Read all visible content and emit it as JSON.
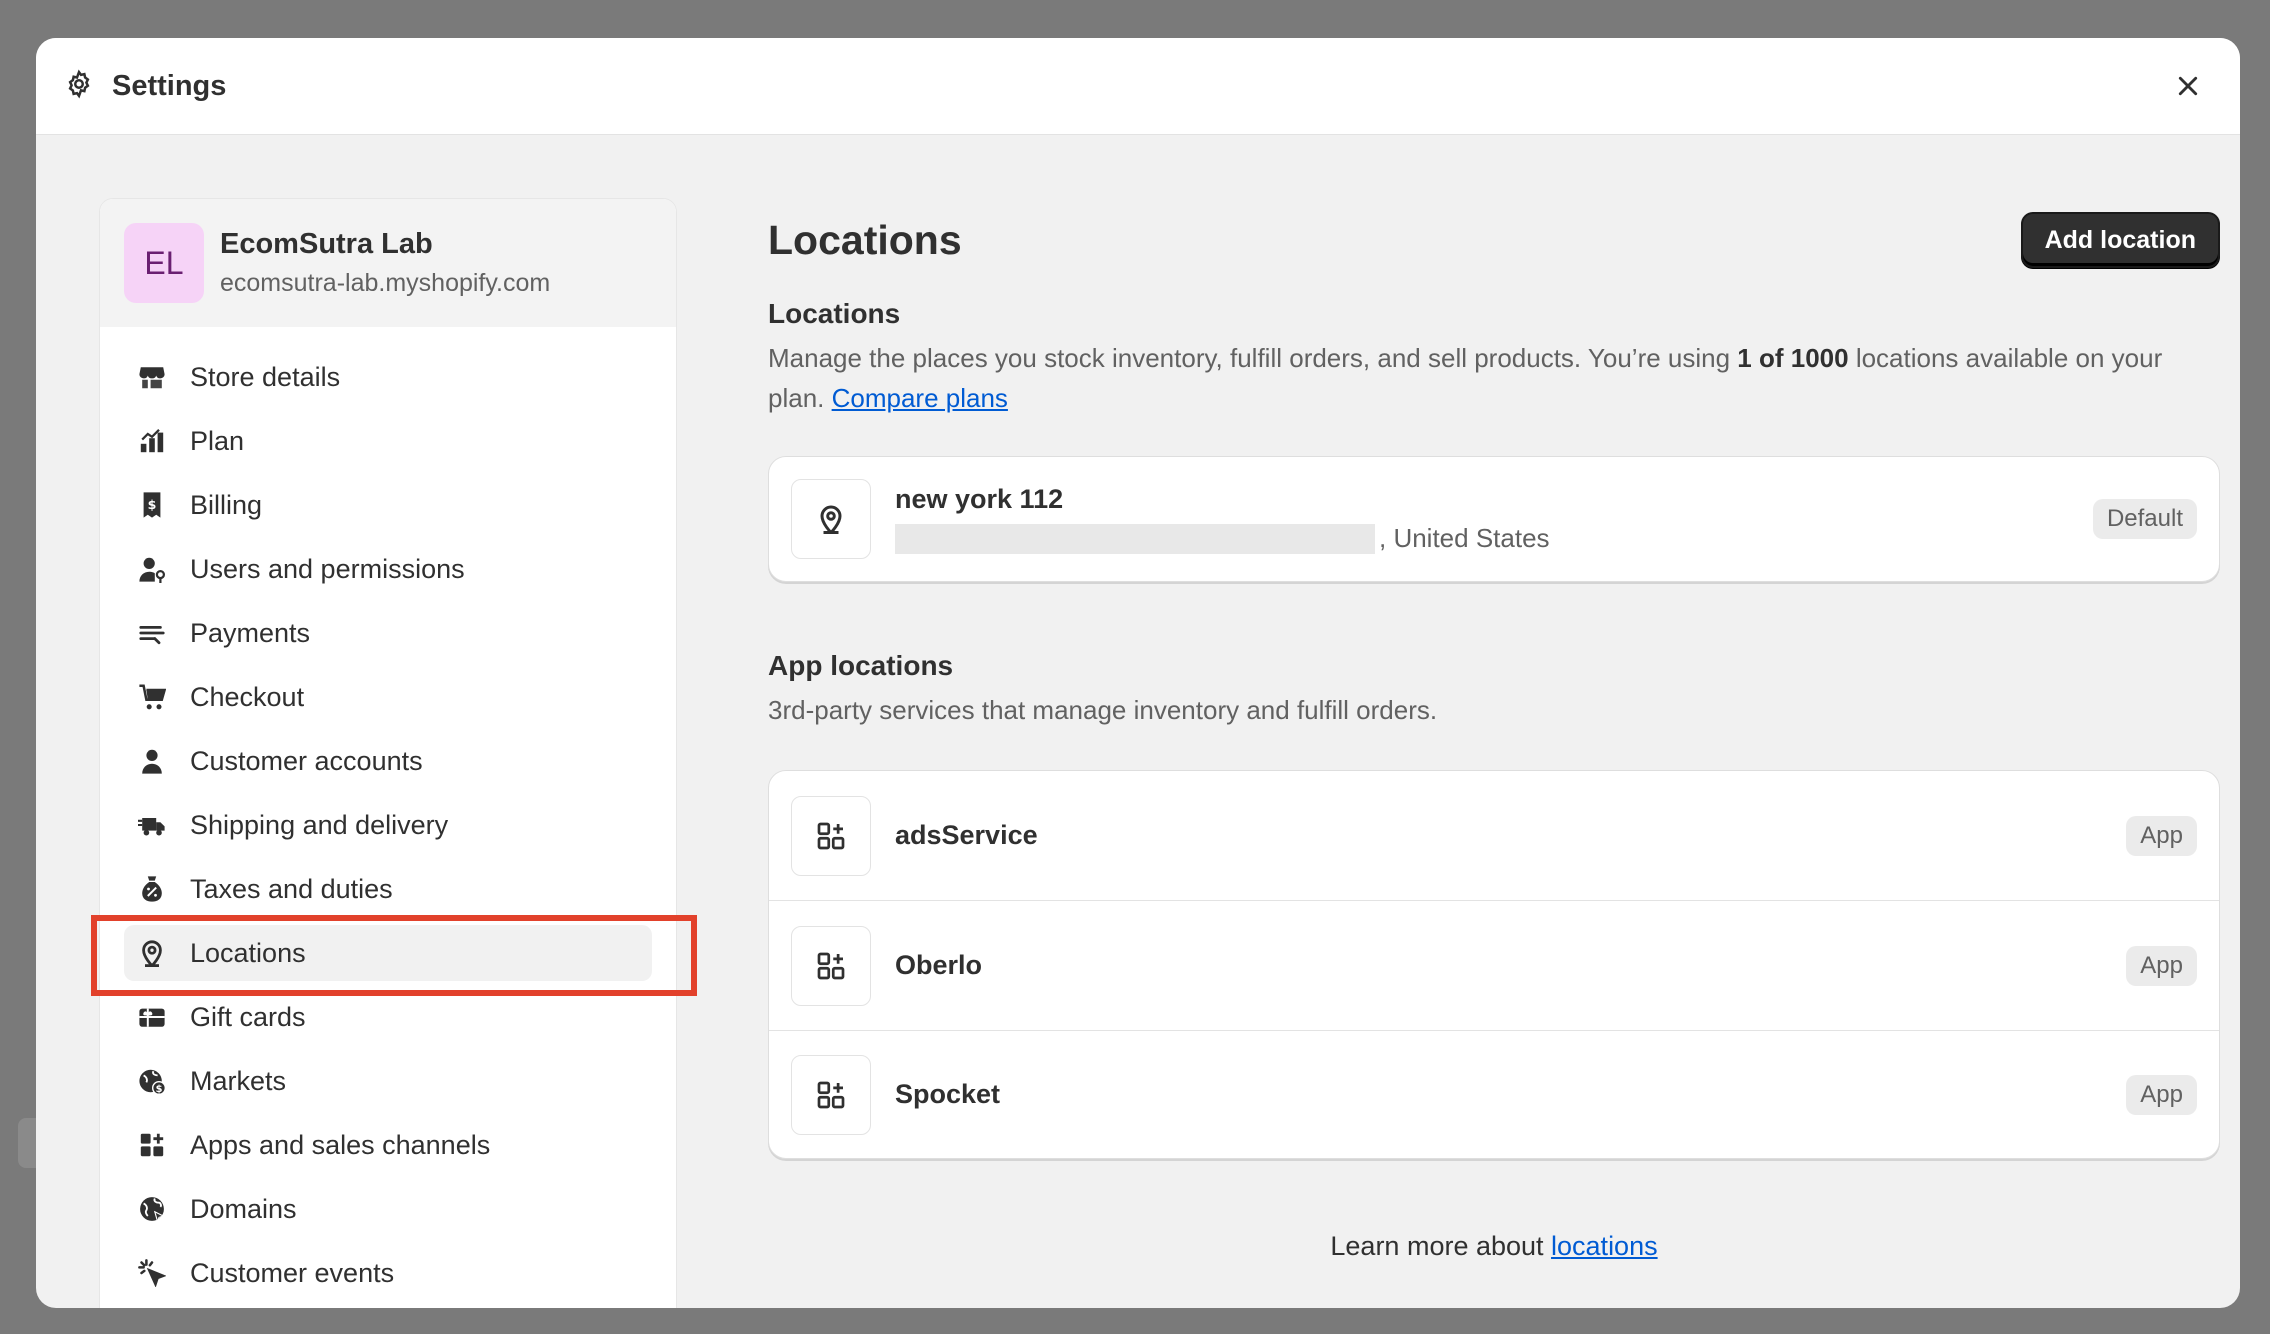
{
  "header": {
    "title": "Settings",
    "settings_icon": "gear-icon",
    "close_icon": "close-icon"
  },
  "store": {
    "initials": "EL",
    "name": "EcomSutra Lab",
    "domain": "ecomsutra-lab.myshopify.com",
    "avatar_color": "#f6d3f7"
  },
  "sidebar": {
    "items": [
      {
        "label": "Store details",
        "icon": "store-icon"
      },
      {
        "label": "Plan",
        "icon": "plan-icon"
      },
      {
        "label": "Billing",
        "icon": "billing-icon"
      },
      {
        "label": "Users and permissions",
        "icon": "users-icon"
      },
      {
        "label": "Payments",
        "icon": "payments-icon"
      },
      {
        "label": "Checkout",
        "icon": "cart-icon"
      },
      {
        "label": "Customer accounts",
        "icon": "person-icon"
      },
      {
        "label": "Shipping and delivery",
        "icon": "truck-icon"
      },
      {
        "label": "Taxes and duties",
        "icon": "tax-icon"
      },
      {
        "label": "Locations",
        "icon": "location-pin-icon",
        "active": true
      },
      {
        "label": "Gift cards",
        "icon": "gift-card-icon"
      },
      {
        "label": "Markets",
        "icon": "globe-currency-icon"
      },
      {
        "label": "Apps and sales channels",
        "icon": "apps-icon"
      },
      {
        "label": "Domains",
        "icon": "globe-icon"
      },
      {
        "label": "Customer events",
        "icon": "cursor-click-icon"
      }
    ]
  },
  "main": {
    "page_title": "Locations",
    "add_button": "Add location",
    "locations_section": {
      "title": "Locations",
      "desc_part1": "Manage the places you stock inventory, fulfill orders, and sell products. You’re using ",
      "desc_bold": "1 of 1000",
      "desc_part2": " locations available on your plan. ",
      "compare_link": "Compare plans"
    },
    "location": {
      "name": "new york 112",
      "address_suffix": ", United States",
      "badge": "Default"
    },
    "app_section": {
      "title": "App locations",
      "desc": "3rd-party services that manage inventory and fulfill orders."
    },
    "app_locations": [
      {
        "name": "adsService",
        "badge": "App"
      },
      {
        "name": "Oberlo",
        "badge": "App"
      },
      {
        "name": "Spocket",
        "badge": "App"
      }
    ],
    "footer_prefix": "Learn more about ",
    "footer_link": "locations"
  },
  "colors": {
    "accent_link": "#005bd3",
    "highlight": "#e2412b",
    "primary_button": "#303030"
  }
}
